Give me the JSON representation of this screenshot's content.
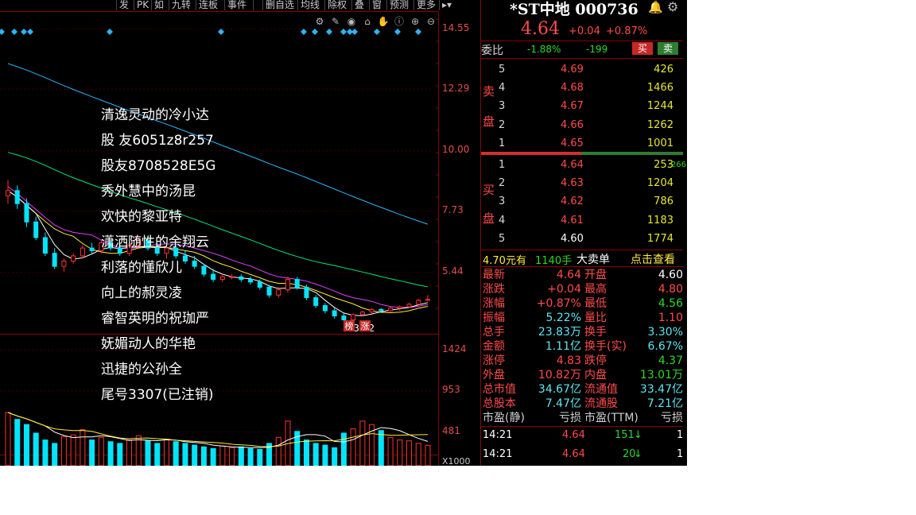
{
  "toolbar": {
    "items": [
      "发",
      "PK",
      "如",
      "九转",
      "连板",
      "事件",
      "",
      "删自选",
      "均线",
      "除权",
      "叠",
      "窗",
      "预测",
      "更多"
    ],
    "icons": [
      "settings-icon",
      "pen-icon",
      "eye-icon",
      "lock-icon",
      "hand-icon",
      "info-icon",
      "zoom-in-icon",
      "zoom-out-icon"
    ]
  },
  "chart": {
    "price_axis": [
      "14.55",
      "12.29",
      "10.00",
      "7.73",
      "5.44"
    ],
    "volume_axis": [
      "1424",
      "953",
      "481"
    ],
    "volume_unit": "X1000",
    "low_marker": "3.72",
    "badges": [
      "榜",
      "涨"
    ],
    "colors": {
      "up": "#ff3030",
      "down": "#00e5ff",
      "ma5": "#ffffff",
      "ma10": "#ffeb3b",
      "ma20": "#e040fb",
      "ma60": "#00e676",
      "ma120": "#29b6f6"
    }
  },
  "chart_data": {
    "type": "candlestick",
    "price_ylim": [
      3.5,
      15.0
    ],
    "candles": [
      {
        "o": 8.6,
        "h": 9.2,
        "l": 8.3,
        "c": 8.8
      },
      {
        "o": 8.8,
        "h": 9.0,
        "l": 8.1,
        "c": 8.3
      },
      {
        "o": 8.3,
        "h": 8.5,
        "l": 7.4,
        "c": 7.6
      },
      {
        "o": 7.6,
        "h": 7.8,
        "l": 6.9,
        "c": 7.0
      },
      {
        "o": 7.0,
        "h": 7.2,
        "l": 6.3,
        "c": 6.4
      },
      {
        "o": 6.4,
        "h": 6.6,
        "l": 5.8,
        "c": 5.9
      },
      {
        "o": 5.9,
        "h": 6.2,
        "l": 5.7,
        "c": 6.1
      },
      {
        "o": 6.1,
        "h": 6.4,
        "l": 6.0,
        "c": 6.3
      },
      {
        "o": 6.3,
        "h": 6.7,
        "l": 6.2,
        "c": 6.6
      },
      {
        "o": 6.6,
        "h": 6.8,
        "l": 6.4,
        "c": 6.5
      },
      {
        "o": 6.5,
        "h": 6.9,
        "l": 6.4,
        "c": 6.8
      },
      {
        "o": 6.8,
        "h": 6.9,
        "l": 6.5,
        "c": 6.6
      },
      {
        "o": 6.6,
        "h": 6.8,
        "l": 6.3,
        "c": 6.4
      },
      {
        "o": 6.4,
        "h": 6.8,
        "l": 6.3,
        "c": 6.7
      },
      {
        "o": 6.7,
        "h": 7.0,
        "l": 6.6,
        "c": 6.9
      },
      {
        "o": 6.9,
        "h": 7.0,
        "l": 6.5,
        "c": 6.6
      },
      {
        "o": 6.6,
        "h": 6.8,
        "l": 6.3,
        "c": 6.4
      },
      {
        "o": 6.4,
        "h": 6.7,
        "l": 6.2,
        "c": 6.6
      },
      {
        "o": 6.6,
        "h": 6.7,
        "l": 6.2,
        "c": 6.3
      },
      {
        "o": 6.3,
        "h": 6.5,
        "l": 6.0,
        "c": 6.1
      },
      {
        "o": 6.1,
        "h": 6.3,
        "l": 5.8,
        "c": 5.9
      },
      {
        "o": 5.9,
        "h": 6.0,
        "l": 5.5,
        "c": 5.6
      },
      {
        "o": 5.6,
        "h": 5.8,
        "l": 5.3,
        "c": 5.4
      },
      {
        "o": 5.4,
        "h": 5.6,
        "l": 5.3,
        "c": 5.5
      },
      {
        "o": 5.5,
        "h": 5.6,
        "l": 5.4,
        "c": 5.5
      },
      {
        "o": 5.5,
        "h": 5.6,
        "l": 5.3,
        "c": 5.4
      },
      {
        "o": 5.4,
        "h": 5.5,
        "l": 5.2,
        "c": 5.3
      },
      {
        "o": 5.3,
        "h": 5.4,
        "l": 5.0,
        "c": 5.1
      },
      {
        "o": 5.1,
        "h": 5.2,
        "l": 4.7,
        "c": 4.8
      },
      {
        "o": 4.8,
        "h": 5.1,
        "l": 4.7,
        "c": 5.0
      },
      {
        "o": 5.0,
        "h": 5.5,
        "l": 4.9,
        "c": 5.4
      },
      {
        "o": 5.4,
        "h": 5.5,
        "l": 5.0,
        "c": 5.1
      },
      {
        "o": 5.1,
        "h": 5.2,
        "l": 4.6,
        "c": 4.7
      },
      {
        "o": 4.7,
        "h": 4.8,
        "l": 4.3,
        "c": 4.4
      },
      {
        "o": 4.4,
        "h": 4.5,
        "l": 4.1,
        "c": 4.2
      },
      {
        "o": 4.2,
        "h": 4.3,
        "l": 3.9,
        "c": 4.0
      },
      {
        "o": 4.0,
        "h": 4.1,
        "l": 3.72,
        "c": 3.85
      },
      {
        "o": 3.85,
        "h": 4.1,
        "l": 3.8,
        "c": 4.05
      },
      {
        "o": 4.05,
        "h": 4.2,
        "l": 4.0,
        "c": 4.15
      },
      {
        "o": 4.15,
        "h": 4.3,
        "l": 4.1,
        "c": 4.25
      },
      {
        "o": 4.25,
        "h": 4.3,
        "l": 4.15,
        "c": 4.2
      },
      {
        "o": 4.2,
        "h": 4.35,
        "l": 4.15,
        "c": 4.3
      },
      {
        "o": 4.3,
        "h": 4.4,
        "l": 4.2,
        "c": 4.35
      },
      {
        "o": 4.35,
        "h": 4.5,
        "l": 4.3,
        "c": 4.45
      },
      {
        "o": 4.45,
        "h": 4.65,
        "l": 4.4,
        "c": 4.6
      },
      {
        "o": 4.6,
        "h": 4.8,
        "l": 4.56,
        "c": 4.64
      }
    ],
    "volumes": [
      620,
      540,
      480,
      380,
      300,
      260,
      340,
      360,
      420,
      300,
      330,
      280,
      260,
      300,
      350,
      290,
      260,
      310,
      280,
      260,
      240,
      220,
      200,
      230,
      210,
      220,
      200,
      190,
      260,
      330,
      520,
      400,
      300,
      260,
      240,
      210,
      380,
      430,
      520,
      480,
      410,
      330,
      300,
      290,
      260,
      238
    ]
  },
  "overlay_names": [
    "清逸灵动的冷小达",
    "股 友6051z8r257",
    "股友8708528E5G",
    "秀外慧中的汤昆",
    "欢快的黎亚特",
    "潇洒随性的余翔云",
    "利落的懂欣儿",
    "向上的郝灵凌",
    "睿智英明的祝珈严",
    "妩媚动人的华艳",
    "迅捷的公孙全",
    "尾号3307(已注销)"
  ],
  "stock": {
    "name": "*ST中地 000736",
    "price": "4.64",
    "change": "+0.04",
    "change_pct": "+0.87%"
  },
  "weibi": {
    "label": "委比",
    "ratio": "-1.88%",
    "diff": "-199",
    "buy_btn": "买",
    "sell_btn": "卖"
  },
  "asks": {
    "side_label": [
      "卖",
      "盘"
    ],
    "rows": [
      {
        "level": "5",
        "price": "4.69",
        "vol": "426"
      },
      {
        "level": "4",
        "price": "4.68",
        "vol": "1466"
      },
      {
        "level": "3",
        "price": "4.67",
        "vol": "1244"
      },
      {
        "level": "2",
        "price": "4.66",
        "vol": "1262"
      },
      {
        "level": "1",
        "price": "4.65",
        "vol": "1001"
      }
    ]
  },
  "bids": {
    "side_label": [
      "买",
      "盘"
    ],
    "rows": [
      {
        "level": "1",
        "price": "4.64",
        "vol": "253",
        "chg": "-266"
      },
      {
        "level": "2",
        "price": "4.63",
        "vol": "1204",
        "chg": ""
      },
      {
        "level": "3",
        "price": "4.62",
        "vol": "786",
        "chg": ""
      },
      {
        "level": "4",
        "price": "4.61",
        "vol": "1183",
        "chg": ""
      },
      {
        "level": "5",
        "price": "4.60",
        "vol": "1774",
        "chg": ""
      }
    ]
  },
  "big_order": {
    "price": "4.70元有",
    "qty": "1140手",
    "label": "大卖单",
    "link": "点击查看"
  },
  "stats": [
    {
      "k1": "最新",
      "v1": "4.64",
      "c1": "red",
      "k2": "开盘",
      "v2": "4.60",
      "c2": "white"
    },
    {
      "k1": "涨跌",
      "v1": "+0.04",
      "c1": "red",
      "k2": "最高",
      "v2": "4.80",
      "c2": "red"
    },
    {
      "k1": "涨幅",
      "v1": "+0.87%",
      "c1": "red",
      "k2": "最低",
      "v2": "4.56",
      "c2": "green"
    },
    {
      "k1": "振幅",
      "v1": "5.22%",
      "c1": "cyan",
      "k2": "量比",
      "v2": "1.10",
      "c2": "red"
    },
    {
      "k1": "总手",
      "v1": "23.83万",
      "c1": "cyan",
      "k2": "换手",
      "v2": "3.30%",
      "c2": "cyan"
    },
    {
      "k1": "金额",
      "v1": "1.11亿",
      "c1": "cyan",
      "k2": "换手(实)",
      "v2": "6.67%",
      "c2": "cyan"
    },
    {
      "k1": "涨停",
      "v1": "4.83",
      "c1": "red",
      "k2": "跌停",
      "v2": "4.37",
      "c2": "green"
    },
    {
      "k1": "外盘",
      "v1": "10.82万",
      "c1": "red",
      "k2": "内盘",
      "v2": "13.01万",
      "c2": "green"
    },
    {
      "k1": "总市值",
      "v1": "34.67亿",
      "c1": "cyan",
      "k2": "流通值",
      "v2": "33.47亿",
      "c2": "cyan"
    },
    {
      "k1": "总股本",
      "v1": "7.47亿",
      "c1": "cyan",
      "k2": "流通股",
      "v2": "7.21亿",
      "c2": "cyan"
    },
    {
      "k1": "市盈(静)",
      "v1": "亏损",
      "c1": "gray",
      "k2": "市盈(TTM)",
      "v2": "亏损",
      "c2": "gray"
    }
  ],
  "ticks": [
    {
      "time": "14:21",
      "price": "4.64",
      "vol": "151",
      "dir": "↓",
      "count": "1"
    },
    {
      "time": "14:21",
      "price": "4.64",
      "vol": "20",
      "dir": "↓",
      "count": "1"
    }
  ]
}
